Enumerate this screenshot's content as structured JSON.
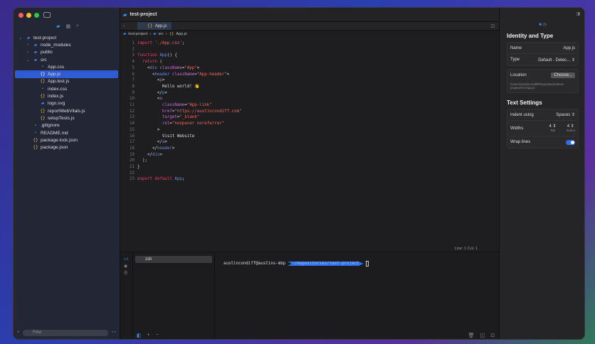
{
  "sidebar": {
    "filter_placeholder": "Filter",
    "tree": [
      {
        "label": "test-project",
        "depth": 0,
        "icon": "folder",
        "chev": "⌄"
      },
      {
        "label": "node_modules",
        "depth": 1,
        "icon": "folder",
        "chev": "›"
      },
      {
        "label": "public",
        "depth": 1,
        "icon": "folder",
        "chev": "›"
      },
      {
        "label": "src",
        "depth": 1,
        "icon": "folder",
        "chev": "⌄"
      },
      {
        "label": "App.css",
        "depth": 2,
        "icon": "doc"
      },
      {
        "label": "App.js",
        "depth": 2,
        "icon": "brace",
        "selected": true
      },
      {
        "label": "App.test.js",
        "depth": 2,
        "icon": "brace"
      },
      {
        "label": "index.css",
        "depth": 2,
        "icon": "doc"
      },
      {
        "label": "index.js",
        "depth": 2,
        "icon": "brace"
      },
      {
        "label": "logo.svg",
        "depth": 2,
        "icon": "folder"
      },
      {
        "label": "reportWebVitals.js",
        "depth": 2,
        "icon": "brace"
      },
      {
        "label": "setupTests.js",
        "depth": 2,
        "icon": "brace"
      },
      {
        "label": ".gitignore",
        "depth": 1,
        "icon": "doc"
      },
      {
        "label": "README.md",
        "depth": 1,
        "icon": "doc"
      },
      {
        "label": "package-lock.json",
        "depth": 1,
        "icon": "brace"
      },
      {
        "label": "package.json",
        "depth": 1,
        "icon": "brace"
      }
    ]
  },
  "editor": {
    "project_title": "test-project",
    "tab": "App.js",
    "breadcrumb": [
      "test-project",
      "src",
      "App.js"
    ],
    "status": "Line: 1  Col: 1",
    "code": [
      [
        [
          "kw",
          "import "
        ],
        [
          "str",
          "'./App.css'"
        ],
        [
          "pl",
          ";"
        ]
      ],
      [],
      [
        [
          "kw",
          "function "
        ],
        [
          "tag",
          "App"
        ],
        [
          "pl",
          "() {"
        ]
      ],
      [
        [
          "pl",
          "  "
        ],
        [
          "kw",
          "return"
        ],
        [
          "pl",
          " ("
        ]
      ],
      [
        [
          "pl",
          "    <"
        ],
        [
          "tag",
          "div "
        ],
        [
          "attr",
          "className"
        ],
        [
          "pl",
          "="
        ],
        [
          "str",
          "\"App\""
        ],
        [
          "pl",
          ">"
        ]
      ],
      [
        [
          "pl",
          "      <"
        ],
        [
          "tag",
          "header "
        ],
        [
          "attr",
          "className"
        ],
        [
          "pl",
          "="
        ],
        [
          "str",
          "\"App-header\""
        ],
        [
          "pl",
          ">"
        ]
      ],
      [
        [
          "pl",
          "        <"
        ],
        [
          "tag",
          "p"
        ],
        [
          "pl",
          ">"
        ]
      ],
      [
        [
          "pl",
          "          Hello world! 👋"
        ]
      ],
      [
        [
          "pl",
          "        </"
        ],
        [
          "tag",
          "p"
        ],
        [
          "pl",
          ">"
        ]
      ],
      [
        [
          "pl",
          "        <"
        ],
        [
          "tag",
          "a"
        ]
      ],
      [
        [
          "pl",
          "          "
        ],
        [
          "attr",
          "className"
        ],
        [
          "pl",
          "="
        ],
        [
          "str",
          "\"App-link\""
        ]
      ],
      [
        [
          "pl",
          "          "
        ],
        [
          "attr",
          "href"
        ],
        [
          "pl",
          "="
        ],
        [
          "str",
          "\"https://austincondiff.com\""
        ]
      ],
      [
        [
          "pl",
          "          "
        ],
        [
          "attr",
          "target"
        ],
        [
          "pl",
          "="
        ],
        [
          "str",
          "\"_blank\""
        ]
      ],
      [
        [
          "pl",
          "          "
        ],
        [
          "attr",
          "rel"
        ],
        [
          "pl",
          "="
        ],
        [
          "str",
          "\"noopener noreferrer\""
        ]
      ],
      [
        [
          "pl",
          "        >"
        ]
      ],
      [
        [
          "pl",
          "          Visit Website"
        ]
      ],
      [
        [
          "pl",
          "        </"
        ],
        [
          "tag",
          "a"
        ],
        [
          "pl",
          ">"
        ]
      ],
      [
        [
          "pl",
          "      </"
        ],
        [
          "tag",
          "header"
        ],
        [
          "pl",
          ">"
        ]
      ],
      [
        [
          "pl",
          "    </"
        ],
        [
          "tag",
          "div"
        ],
        [
          "pl",
          ">"
        ]
      ],
      [
        [
          "pl",
          "  );"
        ]
      ],
      [
        [
          "pl",
          "}"
        ]
      ],
      [],
      [
        [
          "kw",
          "export default "
        ],
        [
          "tag",
          "App"
        ],
        [
          "pl",
          ";"
        ]
      ]
    ]
  },
  "terminal": {
    "session": "zsh",
    "prompt_user": "austincondiff@austins-mbp",
    "prompt_path": "~/Repositories/test-project"
  },
  "inspector": {
    "identity_title": "Identity and Type",
    "name_label": "Name",
    "name_value": "App.js",
    "type_label": "Type",
    "type_value": "Default - Detec...",
    "location_label": "Location",
    "choose_label": "Choose...",
    "location_path": "/Users/austincondiff/Repositories/test-project/src/App.js",
    "text_settings_title": "Text Settings",
    "indent_label": "Indent using",
    "indent_value": "Spaces",
    "widths_label": "Widths",
    "tab_width": "4",
    "tab_label": "Tab",
    "indent_width": "4",
    "indent_sub_label": "Indent",
    "wrap_label": "Wrap lines",
    "wrap_on": true
  }
}
